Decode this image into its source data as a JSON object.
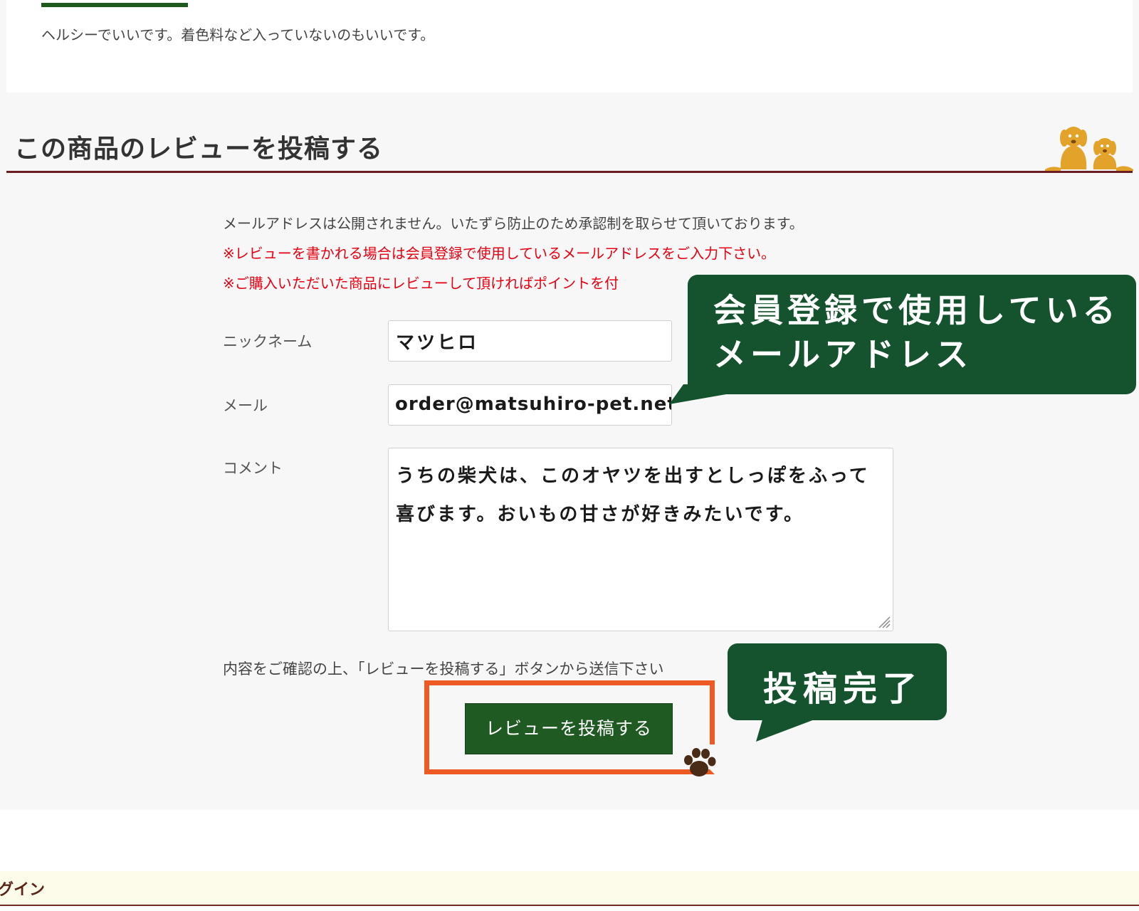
{
  "previous_review": {
    "text": "ヘルシーでいいです。着色料など入っていないのもいいです。"
  },
  "review_form": {
    "title": "この商品のレビューを投稿する",
    "notice_privacy": "メールアドレスは公開されません。いたずら防止のため承認制を取らせて頂いております。",
    "notice_member_email": "※レビューを書かれる場合は会員登録で使用しているメールアドレスをご入力下さい。",
    "notice_points": "※ご購入いただいた商品にレビューして頂ければポイントを付",
    "nickname_label": "ニックネーム",
    "nickname_value": "マツヒロ",
    "email_label": "メール",
    "email_value": "order@matsuhiro-pet.net",
    "comment_label": "コメント",
    "comment_line1": "うちの柴犬は、このオヤツを出すとしっぽをふって",
    "comment_line2": "喜びます。おいもの甘さが好きみたいです。",
    "confirm_text": "内容をご確認の上、「レビューを投稿する」ボタンから送信下さい",
    "submit_label": "レビューを投稿する"
  },
  "callouts": {
    "email_line1": "会員登録で使用している",
    "email_line2": "メールアドレス",
    "submit": "投稿完了"
  },
  "footer": {
    "login_label": "グイン"
  },
  "colors": {
    "accent_green": "#14532d",
    "button_green": "#1f5a23",
    "highlight_orange": "#ee5a24",
    "notice_red": "#e60012",
    "title_rule": "#6b1d22"
  },
  "icons": [
    "dogs-illustration",
    "paw-icon",
    "resize-grip-icon"
  ]
}
